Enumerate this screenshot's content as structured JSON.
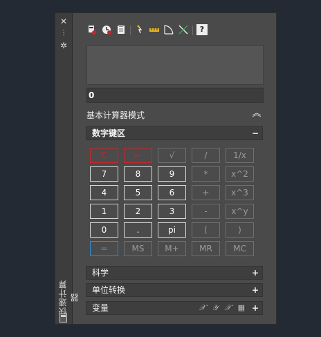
{
  "palette": {
    "title": "快速计算器",
    "colors": {
      "accent_red": "#c8262b",
      "accent_blue": "#2a8fd8",
      "panel_bg": "#4a4a4a"
    }
  },
  "toolbar": {
    "icons": [
      "clear-icon",
      "history-icon",
      "paste-icon",
      "get-coordinates-icon",
      "distance-icon",
      "angle-icon",
      "intersection-icon",
      "help-icon"
    ],
    "help_label": "?"
  },
  "input": {
    "value": "0"
  },
  "mode": {
    "label": "基本计算器模式"
  },
  "numpad": {
    "title": "数字键区",
    "toggle": "−",
    "keys": [
      [
        "C",
        "←",
        "√",
        "/",
        "1/x"
      ],
      [
        "7",
        "8",
        "9",
        "*",
        "x^2"
      ],
      [
        "4",
        "5",
        "6",
        "+",
        "x^3"
      ],
      [
        "1",
        "2",
        "3",
        "-",
        "x^y"
      ],
      [
        "0",
        ".",
        "pi",
        "(",
        ")"
      ],
      [
        "=",
        "MS",
        "M+",
        "MR",
        "MC"
      ]
    ]
  },
  "sections": {
    "scientific": {
      "title": "科学",
      "toggle": "+"
    },
    "units": {
      "title": "单位转换",
      "toggle": "+"
    },
    "variables": {
      "title": "变量",
      "toggle": "+",
      "icons": "𝒳 𝒴 𝒳 ▦"
    }
  }
}
